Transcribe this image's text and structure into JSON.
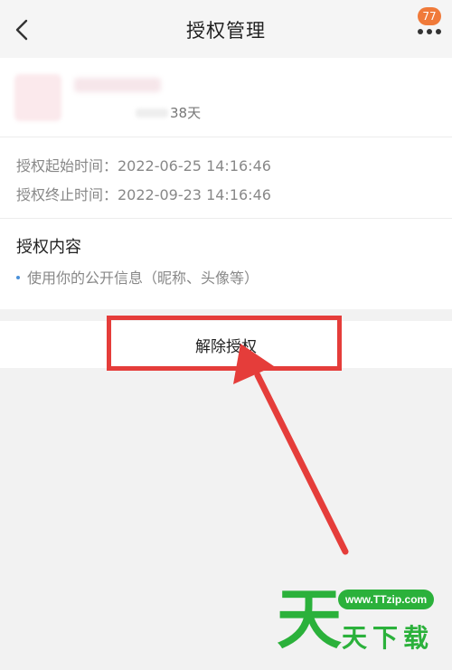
{
  "nav": {
    "title": "授权管理",
    "badge_count": "77",
    "back_icon": "chevron-left-icon",
    "more_icon": "more-dots-icon"
  },
  "app": {
    "days_text": "38天"
  },
  "auth_time": {
    "start": "授权起始时间：2022-06-25 14:16:46",
    "end": "授权终止时间：2022-09-23 14:16:46"
  },
  "content": {
    "title": "授权内容",
    "items": [
      "使用你的公开信息（昵称、头像等）"
    ]
  },
  "revoke": {
    "label": "解除授权"
  },
  "annotation": {
    "color": "#e53d3a"
  },
  "watermark": {
    "url": "www.TTzip.com",
    "big_char": "天",
    "text": "天下载",
    "color": "#2bb13b"
  }
}
